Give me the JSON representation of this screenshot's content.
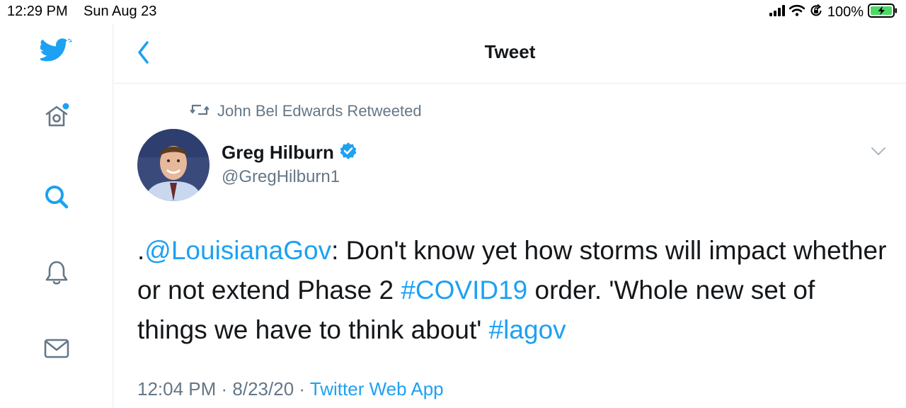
{
  "status_bar": {
    "time": "12:29 PM",
    "date": "Sun Aug 23",
    "battery": "100%",
    "icons": [
      "cellular-signal-icon",
      "wifi-icon",
      "orientation-lock-icon",
      "battery-charging-icon"
    ]
  },
  "sidebar": {
    "items": [
      {
        "icon": "twitter-bird-icon"
      },
      {
        "icon": "home-icon",
        "has_notification_dot": true
      },
      {
        "icon": "search-icon",
        "active": true
      },
      {
        "icon": "bell-icon"
      },
      {
        "icon": "mail-icon"
      }
    ]
  },
  "header": {
    "title": "Tweet",
    "back_icon": "chevron-left-icon"
  },
  "tweet": {
    "retweeted_by": "John Bel Edwards Retweeted",
    "author": {
      "name": "Greg Hilburn",
      "handle": "@GregHilburn1",
      "verified": true
    },
    "text": {
      "prefix": ".",
      "mention": "@LouisianaGov",
      "part1": ": Don't know yet how storms will impact whether or not extend Phase 2 ",
      "hashtag1": "#COVID19",
      "part2": " order. 'Whole new set of things we have to think about' ",
      "hashtag2": "#lagov"
    },
    "meta": {
      "time": "12:04 PM",
      "date": "8/23/20",
      "source": "Twitter Web App",
      "separator": " · "
    }
  },
  "colors": {
    "accent": "#1da1f2",
    "text": "#14171a",
    "secondary": "#657786",
    "border": "#e6ecf0",
    "battery": "#4cd964"
  }
}
